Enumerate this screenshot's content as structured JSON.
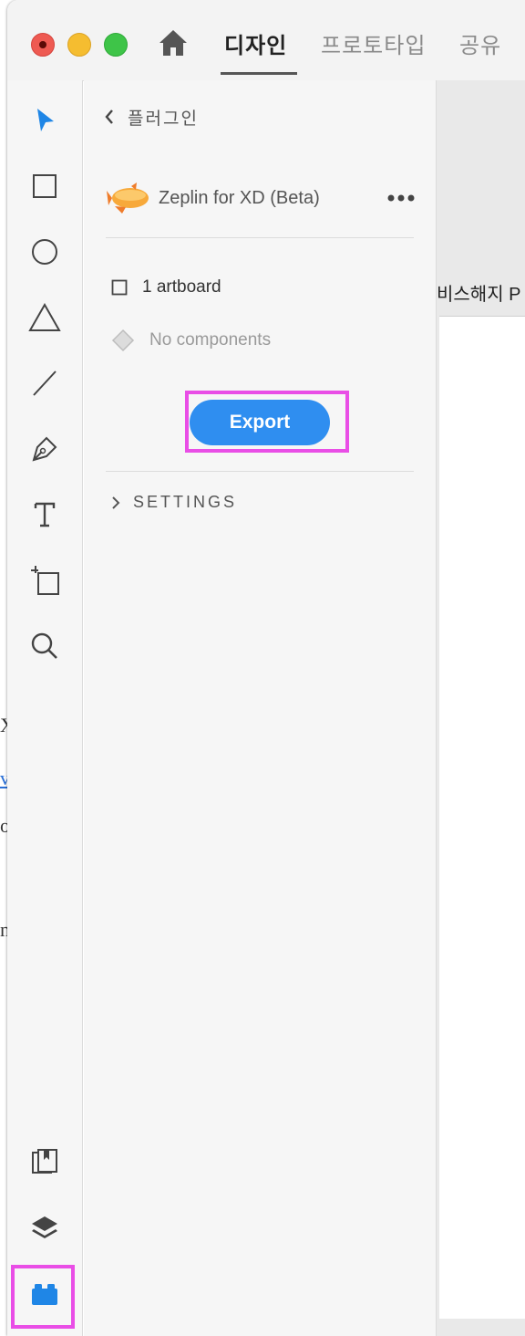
{
  "titlebar": {
    "tabs": [
      {
        "label": "디자인",
        "active": true
      },
      {
        "label": "프로토타입",
        "active": false
      },
      {
        "label": "공유",
        "active": false
      }
    ]
  },
  "toolbar": {
    "tools": [
      "select-icon",
      "rectangle-icon",
      "ellipse-icon",
      "polygon-icon",
      "line-icon",
      "pen-icon",
      "text-icon",
      "artboard-icon",
      "zoom-icon"
    ],
    "bottom_tools": [
      "assets-icon",
      "layers-icon",
      "plugins-icon"
    ],
    "active_tool": "select-icon",
    "highlight_color": "#e94ee6"
  },
  "panel": {
    "breadcrumb": "플러그인",
    "plugin": {
      "name": "Zeplin for XD (Beta)",
      "icon": "zeplin-blimp-icon"
    },
    "artboard_count": "1 artboard",
    "components": "No components",
    "export_label": "Export",
    "settings_label": "SETTINGS",
    "accent_color": "#2f8ef0"
  },
  "canvas": {
    "artboard_label": "비스해지 P"
  }
}
